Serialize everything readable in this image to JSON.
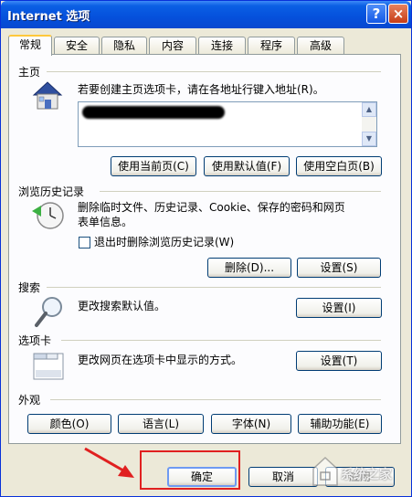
{
  "window": {
    "title": "Internet 选项",
    "help": "?",
    "close": "×"
  },
  "tabs": [
    "常规",
    "安全",
    "隐私",
    "内容",
    "连接",
    "程序",
    "高级"
  ],
  "home": {
    "heading": "主页",
    "description": "若要创建主页选项卡，请在各地址行键入地址(R)。",
    "buttons": {
      "current": "使用当前页(C)",
      "default": "使用默认值(F)",
      "blank": "使用空白页(B)"
    }
  },
  "history": {
    "heading": "浏览历史记录",
    "description_line1": "删除临时文件、历史记录、Cookie、保存的密码和网页",
    "description_line2": "表单信息。",
    "checkbox_label": "退出时删除浏览历史记录(W)",
    "buttons": {
      "delete": "删除(D)...",
      "settings": "设置(S)"
    }
  },
  "search": {
    "heading": "搜索",
    "description": "更改搜索默认值。",
    "settings": "设置(I)"
  },
  "tabs_section": {
    "heading": "选项卡",
    "description": "更改网页在选项卡中显示的方式。",
    "settings": "设置(T)"
  },
  "appearance": {
    "heading": "外观",
    "buttons": {
      "colors": "颜色(O)",
      "languages": "语言(L)",
      "fonts": "字体(N)",
      "accessibility": "辅助功能(E)"
    }
  },
  "footer": {
    "ok": "确定",
    "cancel": "取消",
    "apply": "应用"
  },
  "watermark": {
    "text": "系统之家"
  }
}
